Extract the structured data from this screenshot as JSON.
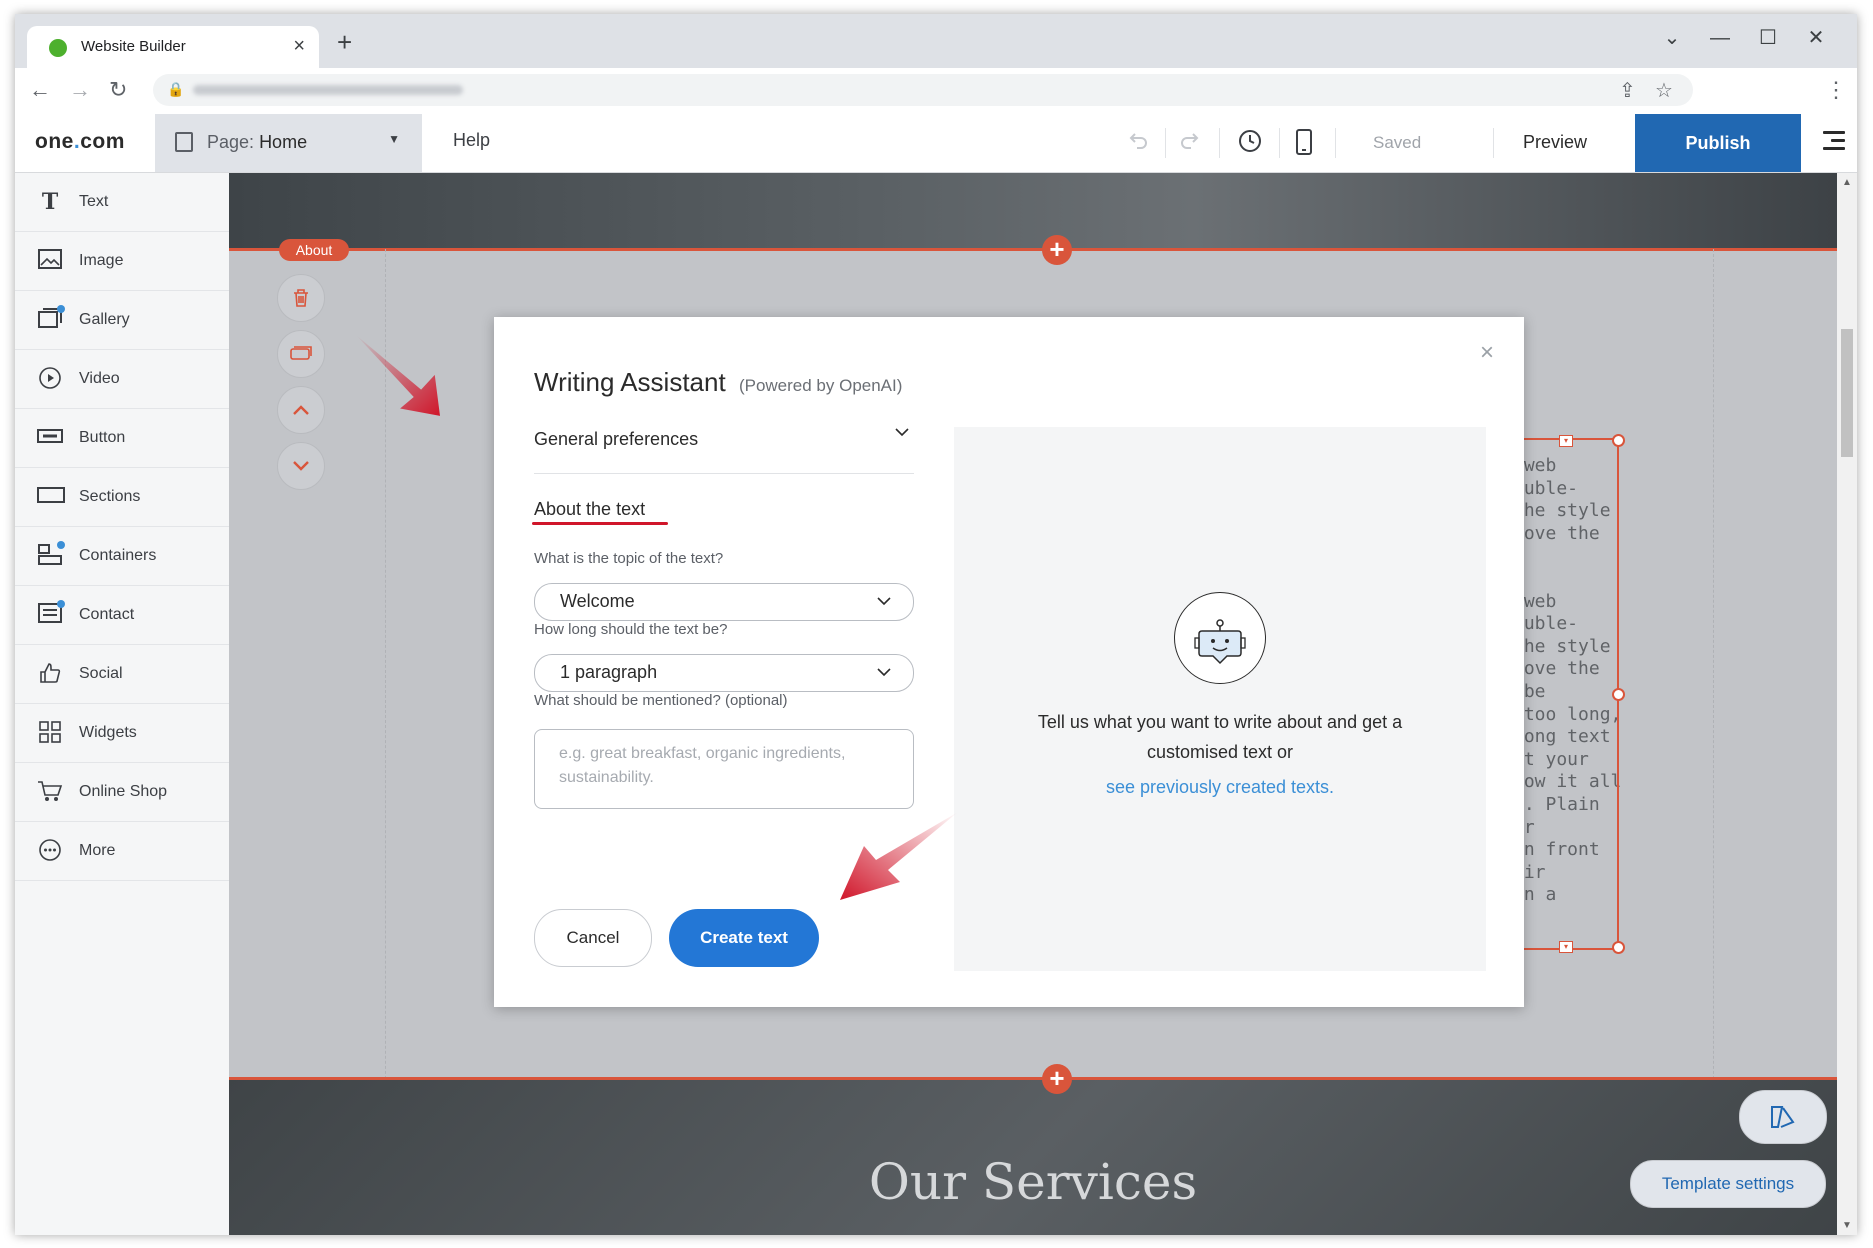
{
  "browser": {
    "tab_title": "Website Builder",
    "tab_close": "×",
    "new_tab": "+",
    "controls": {
      "dropdown": "⌄",
      "minimize": "—",
      "maximize": "☐",
      "close": "✕"
    },
    "nav": {
      "back": "←",
      "forward": "→",
      "reload": "↻"
    },
    "lock": "🔒",
    "share_icon": "⇪",
    "star_icon": "☆",
    "menu_icon": "⋮"
  },
  "toolbar": {
    "logo_left": "one",
    "logo_dot": ".",
    "logo_right": "com",
    "page_prefix": "Page:",
    "page_name": "Home",
    "help": "Help",
    "saved": "Saved",
    "preview": "Preview",
    "publish": "Publish"
  },
  "sidebar": {
    "items": [
      {
        "label": "Text",
        "icon": "T",
        "dot": false
      },
      {
        "label": "Image",
        "icon": "🖼",
        "dot": false
      },
      {
        "label": "Gallery",
        "icon": "▣",
        "dot": true
      },
      {
        "label": "Video",
        "icon": "▷",
        "dot": false
      },
      {
        "label": "Button",
        "icon": "▭",
        "dot": false
      },
      {
        "label": "Sections",
        "icon": "▭",
        "dot": false
      },
      {
        "label": "Containers",
        "icon": "☷",
        "dot": true
      },
      {
        "label": "Contact",
        "icon": "☰",
        "dot": true
      },
      {
        "label": "Social",
        "icon": "👍",
        "dot": false
      },
      {
        "label": "Widgets",
        "icon": "⊞",
        "dot": false
      },
      {
        "label": "Online Shop",
        "icon": "🛒",
        "dot": false
      },
      {
        "label": "More",
        "icon": "⋯",
        "dot": false
      }
    ]
  },
  "canvas": {
    "about_badge": "About",
    "plus": "+",
    "bg_text": " web\nouble-\nthe style\nmove the\n\n\n web\nouble-\nthe style\nmove the\n be\n too long,\nLong text\nut your\nhow it all\ny. Plain\nur\nin front\neir\nan a",
    "services_title": "Our Services",
    "template_settings": "Template settings",
    "template_icon": "✎"
  },
  "modal": {
    "title": "Writing Assistant",
    "title_suffix": "(Powered by OpenAI)",
    "close": "×",
    "general_preferences": "General preferences",
    "about_heading": "About the text",
    "topic_label": "What is the topic of the text?",
    "topic_value": "Welcome",
    "length_label": "How long should the text be?",
    "length_value": "1 paragraph",
    "mention_label": "What should be mentioned? (optional)",
    "mention_placeholder": "e.g. great breakfast, organic ingredients, sustainability.",
    "cancel": "Cancel",
    "create": "Create text",
    "panel_text": "Tell us what you want to write about and get a customised text or",
    "panel_link": "see previously created texts."
  },
  "colors": {
    "accent": "#2168b2",
    "create_button": "#2377d6",
    "selection": "#d9553b",
    "annotation_arrow": "#d0162a"
  }
}
